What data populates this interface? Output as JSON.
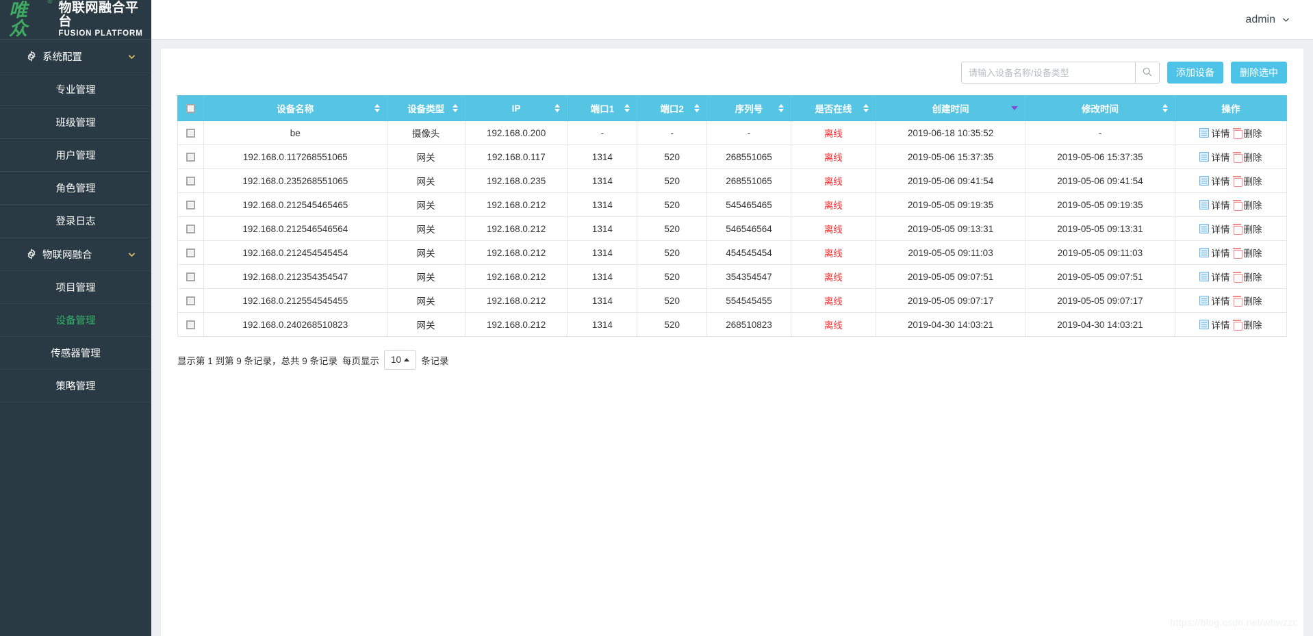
{
  "brand": {
    "logo_mark": "唯众",
    "logo_reg": "®",
    "name_cn": "物联网融合平台",
    "name_en": "FUSION PLATFORM",
    "accent_green": "#33b46a",
    "sidebar_bg": "#2a3a44"
  },
  "topbar": {
    "user_label": "admin",
    "chevron_icon": "chevron-down-icon"
  },
  "sidebar": {
    "groups": [
      {
        "label": "系统配置",
        "icon": "gear-icon",
        "chevron": "chevron-down-icon",
        "items": [
          {
            "label": "专业管理",
            "active": false
          },
          {
            "label": "班级管理",
            "active": false
          },
          {
            "label": "用户管理",
            "active": false
          },
          {
            "label": "角色管理",
            "active": false
          },
          {
            "label": "登录日志",
            "active": false
          }
        ]
      },
      {
        "label": "物联网融合",
        "icon": "gear-icon",
        "chevron": "chevron-down-icon",
        "items": [
          {
            "label": "项目管理",
            "active": false
          },
          {
            "label": "设备管理",
            "active": true
          },
          {
            "label": "传感器管理",
            "active": false
          },
          {
            "label": "策略管理",
            "active": false
          }
        ]
      }
    ]
  },
  "toolbar": {
    "search_placeholder": "请输入设备名称/设备类型",
    "search_value": "",
    "search_icon": "search-icon",
    "add_device_label": "添加设备",
    "delete_selected_label": "删除选中",
    "button_color": "#4ec3e8"
  },
  "table": {
    "header_color": "#56c5e4",
    "columns": [
      {
        "key": "check",
        "label": "",
        "sortable": false
      },
      {
        "key": "name",
        "label": "设备名称",
        "sortable": true
      },
      {
        "key": "type",
        "label": "设备类型",
        "sortable": true
      },
      {
        "key": "ip",
        "label": "IP",
        "sortable": true
      },
      {
        "key": "port1",
        "label": "端口1",
        "sortable": true
      },
      {
        "key": "port2",
        "label": "端口2",
        "sortable": true
      },
      {
        "key": "serial",
        "label": "序列号",
        "sortable": true
      },
      {
        "key": "online",
        "label": "是否在线",
        "sortable": true
      },
      {
        "key": "created",
        "label": "创建时间",
        "sortable": true,
        "sorted": "desc"
      },
      {
        "key": "updated",
        "label": "修改时间",
        "sortable": true
      },
      {
        "key": "action",
        "label": "操作",
        "sortable": false
      }
    ],
    "rows": [
      {
        "name": "be",
        "type": "摄像头",
        "ip": "192.168.0.200",
        "port1": "-",
        "port2": "-",
        "serial": "-",
        "online": "离线",
        "created": "2019-06-18 10:35:52",
        "updated": "-"
      },
      {
        "name": "192.168.0.117268551065",
        "type": "网关",
        "ip": "192.168.0.117",
        "port1": "1314",
        "port2": "520",
        "serial": "268551065",
        "online": "离线",
        "created": "2019-05-06 15:37:35",
        "updated": "2019-05-06 15:37:35"
      },
      {
        "name": "192.168.0.235268551065",
        "type": "网关",
        "ip": "192.168.0.235",
        "port1": "1314",
        "port2": "520",
        "serial": "268551065",
        "online": "离线",
        "created": "2019-05-06 09:41:54",
        "updated": "2019-05-06 09:41:54"
      },
      {
        "name": "192.168.0.212545465465",
        "type": "网关",
        "ip": "192.168.0.212",
        "port1": "1314",
        "port2": "520",
        "serial": "545465465",
        "online": "离线",
        "created": "2019-05-05 09:19:35",
        "updated": "2019-05-05 09:19:35"
      },
      {
        "name": "192.168.0.212546546564",
        "type": "网关",
        "ip": "192.168.0.212",
        "port1": "1314",
        "port2": "520",
        "serial": "546546564",
        "online": "离线",
        "created": "2019-05-05 09:13:31",
        "updated": "2019-05-05 09:13:31"
      },
      {
        "name": "192.168.0.212454545454",
        "type": "网关",
        "ip": "192.168.0.212",
        "port1": "1314",
        "port2": "520",
        "serial": "454545454",
        "online": "离线",
        "created": "2019-05-05 09:11:03",
        "updated": "2019-05-05 09:11:03"
      },
      {
        "name": "192.168.0.212354354547",
        "type": "网关",
        "ip": "192.168.0.212",
        "port1": "1314",
        "port2": "520",
        "serial": "354354547",
        "online": "离线",
        "created": "2019-05-05 09:07:51",
        "updated": "2019-05-05 09:07:51"
      },
      {
        "name": "192.168.0.212554545455",
        "type": "网关",
        "ip": "192.168.0.212",
        "port1": "1314",
        "port2": "520",
        "serial": "554545455",
        "online": "离线",
        "created": "2019-05-05 09:07:17",
        "updated": "2019-05-05 09:07:17"
      },
      {
        "name": "192.168.0.240268510823",
        "type": "网关",
        "ip": "192.168.0.212",
        "port1": "1314",
        "port2": "520",
        "serial": "268510823",
        "online": "离线",
        "created": "2019-04-30 14:03:21",
        "updated": "2019-04-30 14:03:21"
      }
    ],
    "row_actions": {
      "detail_label": "详情",
      "detail_icon": "document-icon",
      "delete_label": "删除",
      "delete_icon": "trash-icon"
    },
    "offline_color": "#ff2b2b"
  },
  "pager": {
    "summary_prefix": "显示第 1 到第 9 条记录，总共 9 条记录",
    "page_size_label": "每页显示",
    "page_size_value": "10",
    "page_size_caret": "caret-up-icon",
    "records_suffix": "条记录"
  },
  "watermark": {
    "text": "https://blog.csdn.net/whwzzc"
  }
}
